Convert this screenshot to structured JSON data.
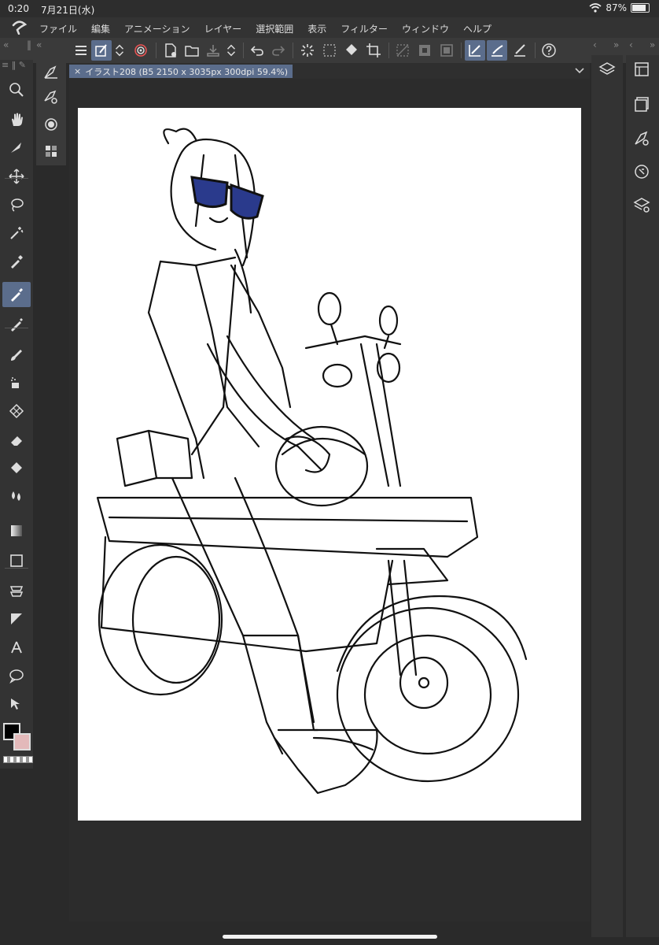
{
  "status": {
    "time": "0:20",
    "date": "7月21日(水)",
    "battery": "87%",
    "battery_level": 0.87
  },
  "menu": {
    "items": [
      "ファイル",
      "編集",
      "アニメーション",
      "レイヤー",
      "選択範囲",
      "表示",
      "フィルター",
      "ウィンドウ",
      "ヘルプ"
    ]
  },
  "document": {
    "tab_title": "イラスト208 (B5 2150 x 3035px 300dpi 59.4%)",
    "close_glyph": "×"
  },
  "colors": {
    "main": "#000000",
    "sub": "#e3b9ba",
    "accent": "#5b6d8c",
    "lens": "#2a3a8c"
  },
  "icons": {
    "command_bar": [
      "hamburger-icon",
      "active-tool-icon",
      "stepper-icon",
      "spiral-icon",
      "new-file-icon",
      "open-folder-icon",
      "save-icon",
      "stepper-icon",
      "undo-icon",
      "redo-icon",
      "loading-icon",
      "select-all-icon",
      "fill-icon",
      "crop-icon",
      "deselect-icon",
      "invert-selection-icon",
      "selection-show-icon",
      "ruler-snap-icon",
      "brush-snap-icon",
      "pen-ruler-icon",
      "help-icon"
    ],
    "tools": [
      "zoom-icon",
      "hand-icon",
      "rotate-icon",
      "move-icon",
      "lasso-icon",
      "magic-wand-icon",
      "eyedropper-icon",
      "pen-icon",
      "pencil-icon",
      "brush-icon",
      "airbrush-icon",
      "decoration-icon",
      "eraser-icon",
      "fill-icon",
      "blend-icon",
      "gradient-icon",
      "rectangle-icon",
      "frame-icon",
      "ruler-icon",
      "text-icon",
      "balloon-icon",
      "correction-icon"
    ]
  }
}
